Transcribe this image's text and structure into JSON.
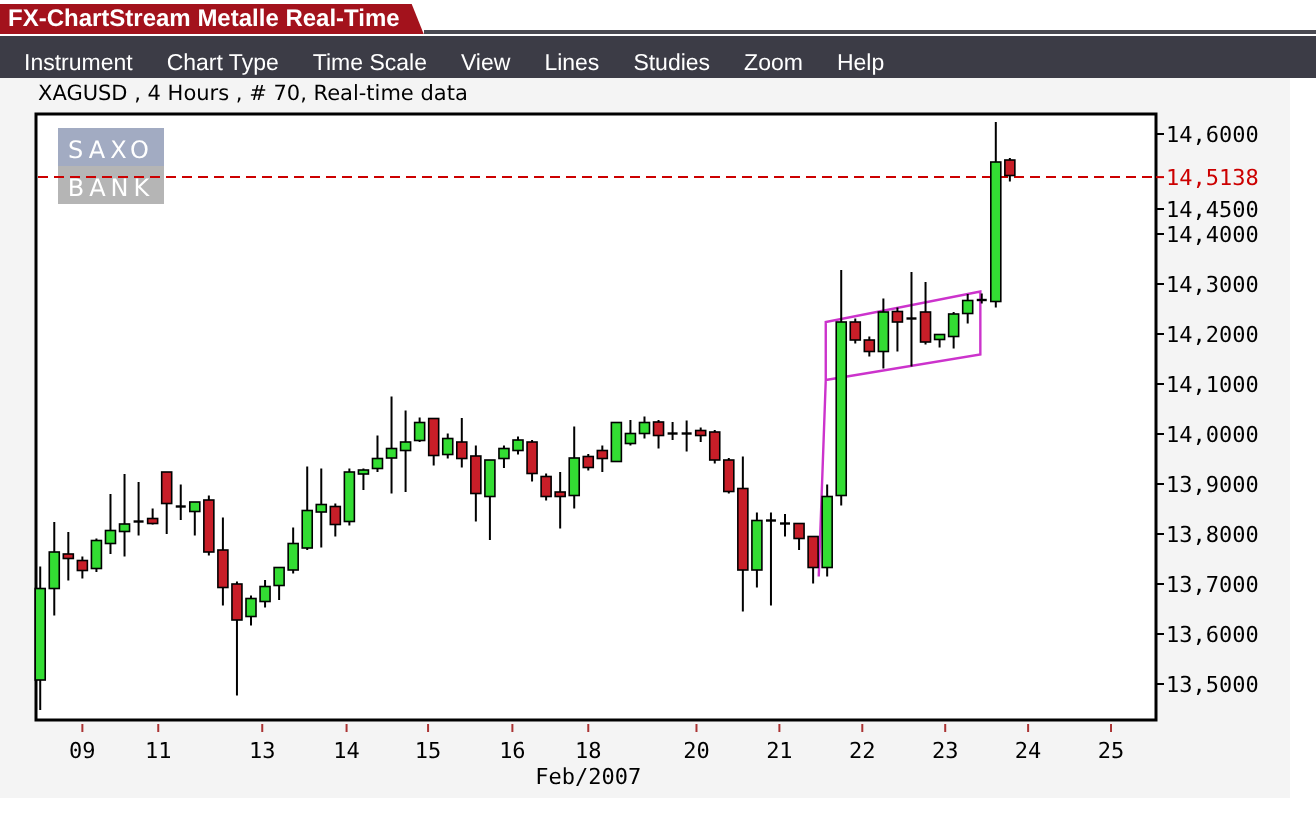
{
  "window": {
    "title": "FX-ChartStream Metalle Real-Time"
  },
  "menu": [
    "Instrument",
    "Chart Type",
    "Time Scale",
    "View",
    "Lines",
    "Studies",
    "Zoom",
    "Help"
  ],
  "info": "XAGUSD , 4 Hours , # 70, Real-time data",
  "logo": {
    "line_1": "SAXO",
    "line_2": "BANK"
  },
  "chart": {
    "y_axis_labels": [
      "14,6000",
      "14,4500",
      "14,4000",
      "14,3000",
      "14,2000",
      "14,1000",
      "14,0000",
      "13,9000",
      "13,8000",
      "13,7000",
      "13,6000",
      "13,5000"
    ],
    "current_price": "14,5138",
    "x_axis_labels": [
      "09",
      "11",
      "13",
      "14",
      "15",
      "16",
      "18",
      "20",
      "21",
      "22",
      "23",
      "24",
      "25"
    ],
    "x_axis_title": "Feb/2007"
  }
}
